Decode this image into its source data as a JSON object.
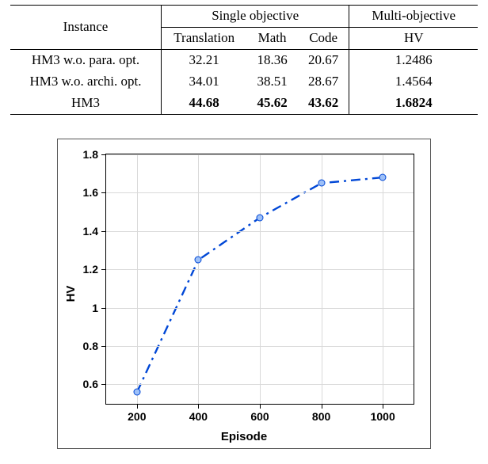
{
  "table": {
    "header_instance": "Instance",
    "header_single": "Single objective",
    "header_multi": "Multi-objective",
    "subheaders": {
      "translation": "Translation",
      "math": "Math",
      "code": "Code",
      "hv": "HV"
    },
    "rows": [
      {
        "name": "HM3 w.o. para. opt.",
        "translation": "32.21",
        "math": "18.36",
        "code": "20.67",
        "hv": "1.2486",
        "bold": false
      },
      {
        "name": "HM3 w.o. archi. opt.",
        "translation": "34.01",
        "math": "38.51",
        "code": "28.67",
        "hv": "1.4564",
        "bold": false
      },
      {
        "name": "HM3",
        "translation": "44.68",
        "math": "45.62",
        "code": "43.62",
        "hv": "1.6824",
        "bold": true
      }
    ]
  },
  "chart_data": {
    "type": "line",
    "title": "",
    "xlabel": "Episode",
    "ylabel": "HV",
    "xlim": [
      100,
      1100
    ],
    "ylim": [
      0.5,
      1.8
    ],
    "xticks": [
      200,
      400,
      600,
      800,
      1000
    ],
    "yticks": [
      0.6,
      0.8,
      1.0,
      1.2,
      1.4,
      1.6,
      1.8
    ],
    "ytick_labels": [
      "0.6",
      "0.8",
      "1",
      "1.2",
      "1.4",
      "1.6",
      "1.8"
    ],
    "xtick_labels": [
      "200",
      "400",
      "600",
      "800",
      "1000"
    ],
    "series": [
      {
        "name": "HV",
        "x": [
          200,
          400,
          600,
          800,
          1000
        ],
        "y": [
          0.56,
          1.25,
          1.47,
          1.65,
          1.68
        ],
        "color": "#0047d6",
        "style": "dash-dot",
        "marker": "o"
      }
    ]
  }
}
